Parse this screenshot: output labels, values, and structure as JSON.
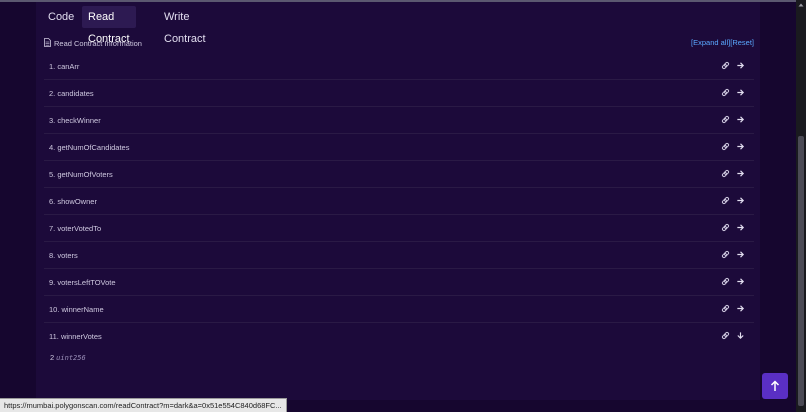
{
  "tabs": [
    {
      "label": "Code",
      "active": false
    },
    {
      "label": "Read Contract",
      "active": true
    },
    {
      "label": "Write Contract",
      "active": false
    }
  ],
  "info": {
    "title": "Read Contract Information",
    "expand_all": "[Expand all]",
    "reset": "[Reset]"
  },
  "functions": [
    {
      "label": "1. canArr"
    },
    {
      "label": "2. candidates"
    },
    {
      "label": "3. checkWinner"
    },
    {
      "label": "4. getNumOfCandidates"
    },
    {
      "label": "5. getNumOfVoters"
    },
    {
      "label": "6. showOwner"
    },
    {
      "label": "7. voterVotedTo"
    },
    {
      "label": "8. voters"
    },
    {
      "label": "9. votersLeftTOVote"
    },
    {
      "label": "10. winnerName"
    },
    {
      "label": "11. winnerVotes"
    }
  ],
  "result": {
    "value": "2",
    "type": "uint256"
  },
  "status_url": "https://mumbai.polygonscan.com/readContract?m=dark&a=0x51e554C840d68FC...",
  "colors": {
    "background": "#16062f",
    "panel": "#1c0a3a",
    "link": "#5aa8ff",
    "accent": "#5a2fc4"
  },
  "icons": {
    "row_link": "link-icon",
    "row_expand": "arrow-right-icon",
    "row_expanded": "arrow-down-icon",
    "back_to_top": "arrow-up-icon"
  }
}
